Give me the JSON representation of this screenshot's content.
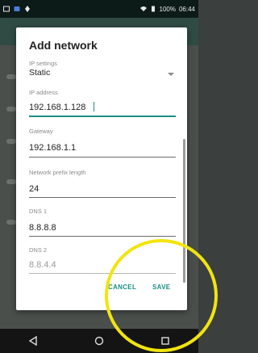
{
  "status_bar": {
    "battery_percent": "100%",
    "time": "06:44"
  },
  "dialog": {
    "title": "Add network",
    "ip_settings": {
      "label": "IP settings",
      "value": "Static"
    },
    "ip_address": {
      "label": "IP address",
      "value": "192.168.1.128"
    },
    "gateway": {
      "label": "Gateway",
      "value": "192.168.1.1"
    },
    "prefix_length": {
      "label": "Network prefix length",
      "value": "24"
    },
    "dns1": {
      "label": "DNS 1",
      "value": "8.8.8.8"
    },
    "dns2": {
      "label": "DNS 2",
      "value": "8.8.4.4"
    },
    "cancel_label": "CANCEL",
    "save_label": "SAVE"
  },
  "colors": {
    "accent": "#1b8f82",
    "highlight": "#f2e40f"
  },
  "icons": [
    "image-icon",
    "notification-icon",
    "wifi-icon",
    "battery-icon",
    "back-icon",
    "home-icon",
    "recents-icon",
    "dropdown-arrow-icon"
  ]
}
